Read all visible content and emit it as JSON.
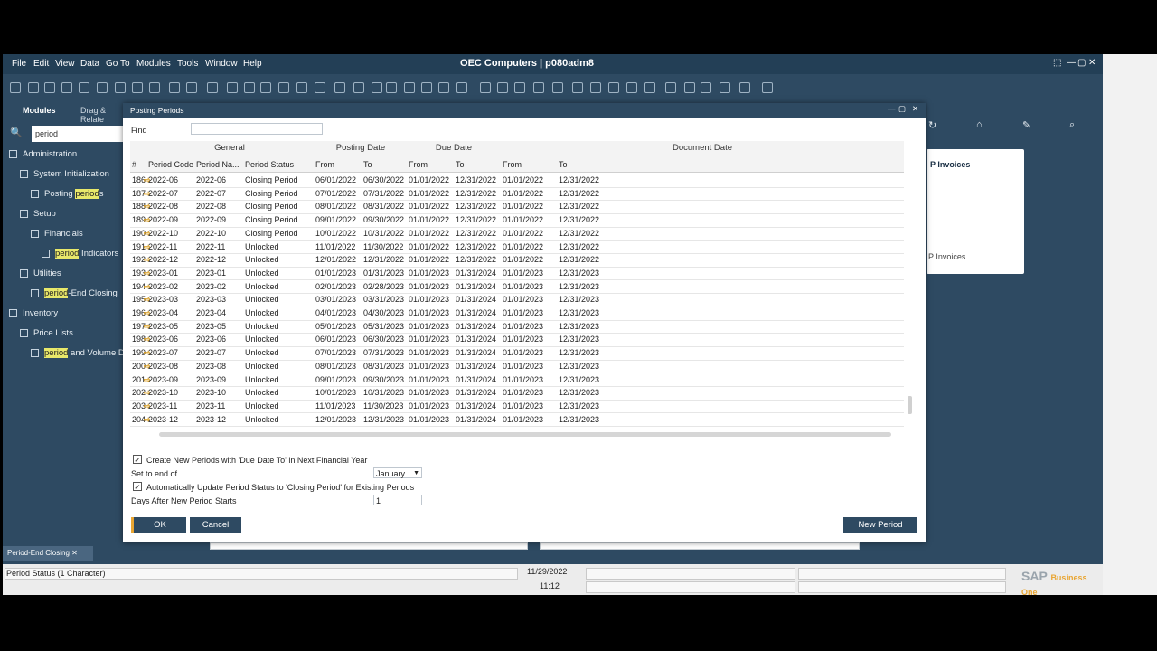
{
  "menu": [
    "File",
    "Edit",
    "View",
    "Data",
    "Go To",
    "Modules",
    "Tools",
    "Window",
    "Help"
  ],
  "app_title": "OEC Computers | p080adm8",
  "left_panel": {
    "tabs": [
      "Modules",
      "Drag & Relate"
    ],
    "search_value": "period",
    "items": [
      {
        "label": "Administration",
        "indent": 0
      },
      {
        "label": "System Initialization",
        "indent": 1
      },
      {
        "pre": "Posting ",
        "hl": "period",
        "post": "s",
        "indent": 2
      },
      {
        "label": "Setup",
        "indent": 1
      },
      {
        "label": "Financials",
        "indent": 2
      },
      {
        "pre": "",
        "hl": "period",
        "post": " Indicators",
        "indent": 3
      },
      {
        "label": "Utilities",
        "indent": 1
      },
      {
        "pre": "",
        "hl": "period",
        "post": "-End Closing",
        "indent": 2
      },
      {
        "label": "Inventory",
        "indent": 0
      },
      {
        "label": "Price Lists",
        "indent": 1
      },
      {
        "pre": "",
        "hl": "period",
        "post": " and Volume Di",
        "indent": 2
      }
    ]
  },
  "dialog": {
    "title": "Posting Periods",
    "find_label": "Find",
    "find_value": "",
    "groups": [
      "General",
      "Posting Date",
      "Due Date",
      "Document Date"
    ],
    "headers": [
      "#",
      "Period Code",
      "Period Na...",
      "Period Status",
      "From",
      "To",
      "From",
      "To",
      "From",
      "To"
    ],
    "rows": [
      [
        "186",
        "2022-06",
        "2022-06",
        "Closing Period",
        "06/01/2022",
        "06/30/2022",
        "01/01/2022",
        "12/31/2022",
        "01/01/2022",
        "12/31/2022"
      ],
      [
        "187",
        "2022-07",
        "2022-07",
        "Closing Period",
        "07/01/2022",
        "07/31/2022",
        "01/01/2022",
        "12/31/2022",
        "01/01/2022",
        "12/31/2022"
      ],
      [
        "188",
        "2022-08",
        "2022-08",
        "Closing Period",
        "08/01/2022",
        "08/31/2022",
        "01/01/2022",
        "12/31/2022",
        "01/01/2022",
        "12/31/2022"
      ],
      [
        "189",
        "2022-09",
        "2022-09",
        "Closing Period",
        "09/01/2022",
        "09/30/2022",
        "01/01/2022",
        "12/31/2022",
        "01/01/2022",
        "12/31/2022"
      ],
      [
        "190",
        "2022-10",
        "2022-10",
        "Closing Period",
        "10/01/2022",
        "10/31/2022",
        "01/01/2022",
        "12/31/2022",
        "01/01/2022",
        "12/31/2022"
      ],
      [
        "191",
        "2022-11",
        "2022-11",
        "Unlocked",
        "11/01/2022",
        "11/30/2022",
        "01/01/2022",
        "12/31/2022",
        "01/01/2022",
        "12/31/2022"
      ],
      [
        "192",
        "2022-12",
        "2022-12",
        "Unlocked",
        "12/01/2022",
        "12/31/2022",
        "01/01/2022",
        "12/31/2022",
        "01/01/2022",
        "12/31/2022"
      ],
      [
        "193",
        "2023-01",
        "2023-01",
        "Unlocked",
        "01/01/2023",
        "01/31/2023",
        "01/01/2023",
        "01/31/2024",
        "01/01/2023",
        "12/31/2023"
      ],
      [
        "194",
        "2023-02",
        "2023-02",
        "Unlocked",
        "02/01/2023",
        "02/28/2023",
        "01/01/2023",
        "01/31/2024",
        "01/01/2023",
        "12/31/2023"
      ],
      [
        "195",
        "2023-03",
        "2023-03",
        "Unlocked",
        "03/01/2023",
        "03/31/2023",
        "01/01/2023",
        "01/31/2024",
        "01/01/2023",
        "12/31/2023"
      ],
      [
        "196",
        "2023-04",
        "2023-04",
        "Unlocked",
        "04/01/2023",
        "04/30/2023",
        "01/01/2023",
        "01/31/2024",
        "01/01/2023",
        "12/31/2023"
      ],
      [
        "197",
        "2023-05",
        "2023-05",
        "Unlocked",
        "05/01/2023",
        "05/31/2023",
        "01/01/2023",
        "01/31/2024",
        "01/01/2023",
        "12/31/2023"
      ],
      [
        "198",
        "2023-06",
        "2023-06",
        "Unlocked",
        "06/01/2023",
        "06/30/2023",
        "01/01/2023",
        "01/31/2024",
        "01/01/2023",
        "12/31/2023"
      ],
      [
        "199",
        "2023-07",
        "2023-07",
        "Unlocked",
        "07/01/2023",
        "07/31/2023",
        "01/01/2023",
        "01/31/2024",
        "01/01/2023",
        "12/31/2023"
      ],
      [
        "200",
        "2023-08",
        "2023-08",
        "Unlocked",
        "08/01/2023",
        "08/31/2023",
        "01/01/2023",
        "01/31/2024",
        "01/01/2023",
        "12/31/2023"
      ],
      [
        "201",
        "2023-09",
        "2023-09",
        "Unlocked",
        "09/01/2023",
        "09/30/2023",
        "01/01/2023",
        "01/31/2024",
        "01/01/2023",
        "12/31/2023"
      ],
      [
        "202",
        "2023-10",
        "2023-10",
        "Unlocked",
        "10/01/2023",
        "10/31/2023",
        "01/01/2023",
        "01/31/2024",
        "01/01/2023",
        "12/31/2023"
      ],
      [
        "203",
        "2023-11",
        "2023-11",
        "Unlocked",
        "11/01/2023",
        "11/30/2023",
        "01/01/2023",
        "01/31/2024",
        "01/01/2023",
        "12/31/2023"
      ],
      [
        "204",
        "2023-12",
        "2023-12",
        "Unlocked",
        "12/01/2023",
        "12/31/2023",
        "01/01/2023",
        "01/31/2024",
        "01/01/2023",
        "12/31/2023"
      ]
    ],
    "option_create": "Create New Periods with 'Due Date To' in Next Financial Year",
    "option_create_checked": true,
    "set_to_end_label": "Set to end of",
    "set_to_end_value": "January",
    "option_auto": "Automatically Update Period Status to 'Closing Period' for Existing Periods",
    "option_auto_checked": true,
    "days_label": "Days After New Period Starts",
    "days_value": "1",
    "ok_label": "OK",
    "cancel_label": "Cancel",
    "new_period_label": "New Period"
  },
  "right_card": {
    "title": "P Invoices",
    "item": "P Invoices"
  },
  "minitab": "Period-End Closing",
  "status": {
    "text": "Period Status (1 Character)",
    "date": "11/29/2022",
    "time": "11:12",
    "logo": "SAP Business One"
  },
  "colors": {
    "chrome": "#2e4a62",
    "menubar": "#233f56",
    "accent": "#d89b1a"
  }
}
